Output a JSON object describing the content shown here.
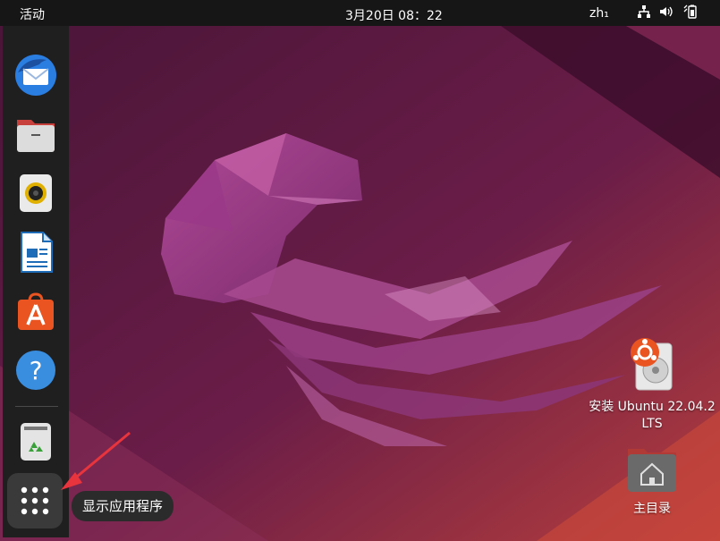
{
  "topbar": {
    "activities_label": "活动",
    "clock": "3月20日  08：22",
    "input_method": "zh₁"
  },
  "dock": {
    "items": [
      {
        "name": "thunderbird-mail",
        "icon": "thunderbird-icon"
      },
      {
        "name": "files",
        "icon": "folder-icon"
      },
      {
        "name": "rhythmbox",
        "icon": "speaker-icon"
      },
      {
        "name": "libreoffice-writer",
        "icon": "document-icon"
      },
      {
        "name": "ubuntu-software",
        "icon": "app-store-icon"
      },
      {
        "name": "help",
        "icon": "help-icon"
      },
      {
        "name": "trash",
        "icon": "trash-icon"
      }
    ],
    "show_apps_tooltip": "显示应用程序"
  },
  "desktop": {
    "install_label": "安装 Ubuntu 22.04.2 LTS",
    "home_label": "主目录"
  },
  "colors": {
    "accent": "#e95420",
    "panel": "#161616",
    "dock": "#1f1f1f",
    "annotation_arrow": "#e8343c"
  }
}
